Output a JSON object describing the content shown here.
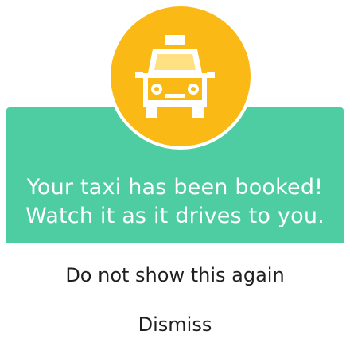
{
  "dialog": {
    "icon": "taxi-icon",
    "message_line1": "Your taxi has been booked!",
    "message_line2": "Watch it as it drives to you.",
    "do_not_show_label": "Do not show this again",
    "dismiss_label": "Dismiss"
  },
  "colors": {
    "banner": "#4ecda3",
    "badge": "#fbb915",
    "text_on_banner": "#ffffff",
    "option_text": "#1f1f1f"
  }
}
